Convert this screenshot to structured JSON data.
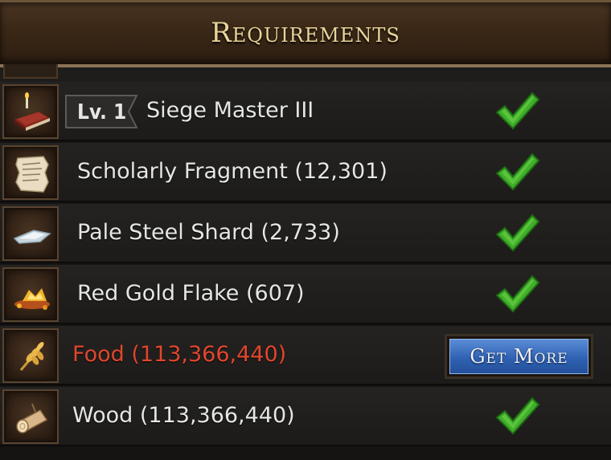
{
  "header": {
    "title": "Requirements"
  },
  "requirements": [
    {
      "level_badge": "Lv. 1",
      "label": "Siege Master III",
      "icon": "skill-book-icon",
      "met": true
    },
    {
      "label": "Scholarly Fragment (12,301)",
      "icon": "parchment-icon",
      "met": true
    },
    {
      "label": "Pale Steel Shard (2,733)",
      "icon": "steel-shard-icon",
      "met": true
    },
    {
      "label": "Red Gold Flake (607)",
      "icon": "gold-flake-icon",
      "met": true
    },
    {
      "label": "Food (113,366,440)",
      "icon": "wheat-icon",
      "met": false,
      "action_label": "Get More"
    },
    {
      "label": "Wood (113,366,440)",
      "icon": "log-icon",
      "met": true
    }
  ],
  "colors": {
    "met_text": "#e6e6e6",
    "unmet_text": "#e0472e",
    "check": "#3fae2a",
    "button": "#2f62b3",
    "title": "#e9d59a"
  }
}
